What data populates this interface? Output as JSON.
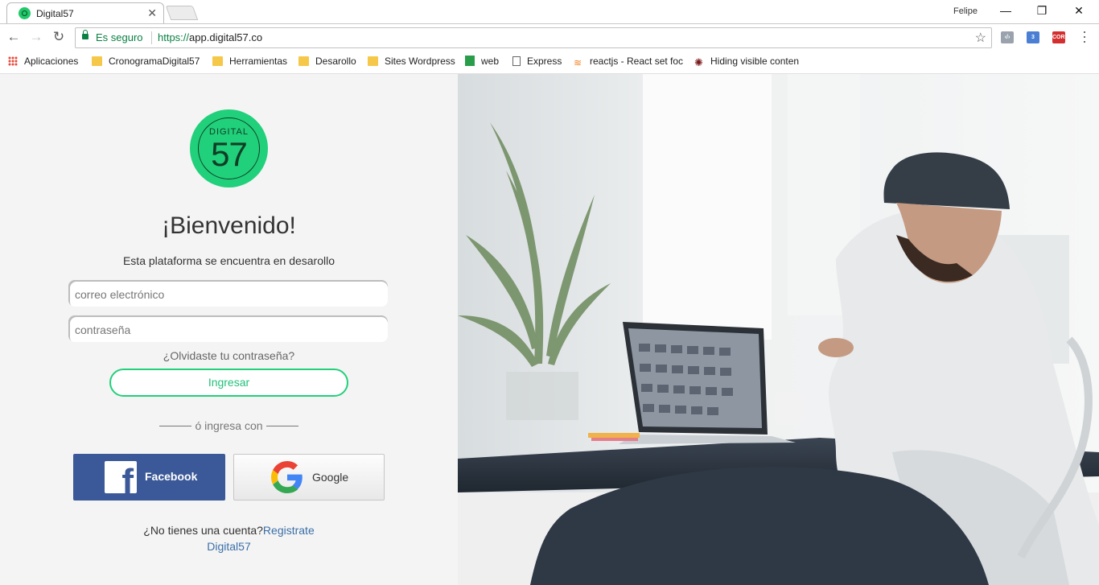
{
  "browser": {
    "tab_title": "Digital57",
    "user_name": "Felipe",
    "secure_label": "Es seguro",
    "url_scheme": "https://",
    "url_rest": "app.digital57.co"
  },
  "bookmarks": [
    {
      "label": "Aplicaciones",
      "icon": "apps-grid-icon"
    },
    {
      "label": "CronogramaDigital57",
      "icon": "folder-icon"
    },
    {
      "label": "Herramientas",
      "icon": "folder-icon"
    },
    {
      "label": "Desarollo",
      "icon": "folder-icon"
    },
    {
      "label": "Sites Wordpress",
      "icon": "folder-icon"
    },
    {
      "label": "web",
      "icon": "spreadsheet-icon"
    },
    {
      "label": "Express",
      "icon": "document-icon"
    },
    {
      "label": "reactjs - React set foc",
      "icon": "stackoverflow-icon"
    },
    {
      "label": "Hiding visible conten",
      "icon": "gear-icon"
    }
  ],
  "extensions": [
    {
      "name": "code-extension-icon",
      "text": "‹/›",
      "color": "#9aa3ad"
    },
    {
      "name": "badge-extension-icon",
      "text": "3",
      "color": "#4a7fd4"
    },
    {
      "name": "cors-extension-icon",
      "text": "CORS",
      "color": "#d32f2f"
    }
  ],
  "logo": {
    "wordmark": "DIGITAL",
    "number": "57",
    "color": "#21d07a"
  },
  "login": {
    "title": "¡Bienvenido!",
    "subtitle": "Esta plataforma se encuentra en desarollo",
    "email_placeholder": "correo electrónico",
    "password_placeholder": "contraseña",
    "forgot_label": "¿Olvidaste tu contraseña?",
    "submit_label": "Ingresar",
    "divider_label": "ó ingresa con",
    "facebook_label": "Facebook",
    "google_label": "Google",
    "no_account_label": "¿No tienes una cuenta?",
    "register_label": "Registrate",
    "register_sub": "Digital57"
  },
  "colors": {
    "accent": "#21d07a",
    "facebook": "#3b5998",
    "link": "#3a6fa8"
  }
}
